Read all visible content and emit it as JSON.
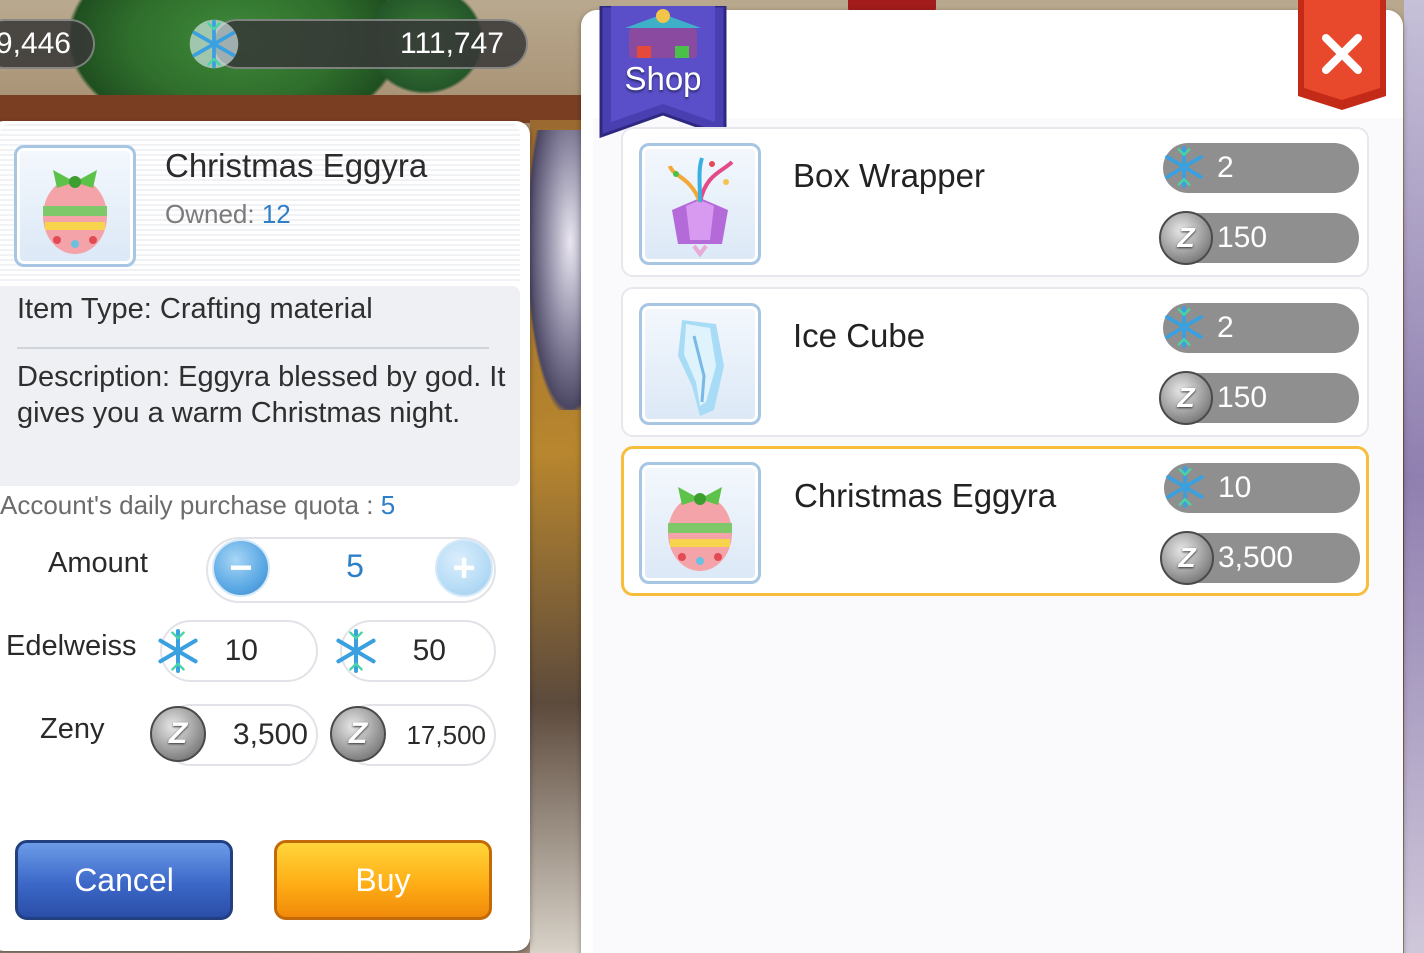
{
  "currencies": {
    "left_value": "9,446",
    "right_value": "111,747"
  },
  "detail": {
    "item_name": "Christmas Eggyra",
    "owned_label": "Owned:",
    "owned_count": "12",
    "item_type": "Item Type: Crafting material",
    "description": "Description: Eggyra blessed by god. It gives you a warm Christmas night.",
    "quota_label": "Account's daily purchase quota :",
    "quota_value": "5",
    "amount_label": "Amount",
    "amount_value": "5",
    "edelweiss_label": "Edelweiss",
    "edelweiss_unit": "10",
    "edelweiss_total": "50",
    "zeny_label": "Zeny",
    "zeny_unit": "3,500",
    "zeny_total": "17,500",
    "cancel_label": "Cancel",
    "buy_label": "Buy"
  },
  "shop": {
    "title": "Shop",
    "items": [
      {
        "name": "Box Wrapper",
        "edelweiss_price": "2",
        "zeny_price": "150",
        "icon": "gift-box-icon"
      },
      {
        "name": "Ice Cube",
        "edelweiss_price": "2",
        "zeny_price": "150",
        "icon": "ice-crystal-icon"
      },
      {
        "name": "Christmas Eggyra",
        "edelweiss_price": "10",
        "zeny_price": "3,500",
        "icon": "easter-egg-icon"
      }
    ]
  },
  "colors": {
    "accent_blue": "#2e7ec8",
    "selected_border": "#f7bd3c",
    "close_red": "#e0402a",
    "shop_flag": "#4a3fb0"
  }
}
